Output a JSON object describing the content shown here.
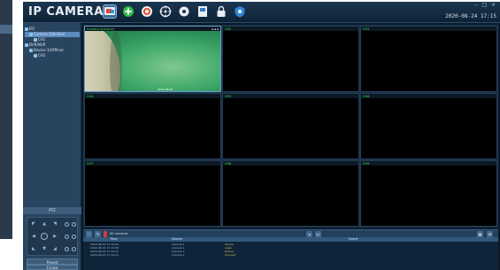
{
  "app": {
    "title": "IP CAMERA",
    "datetime": "2020-08-24 17:15"
  },
  "toolbar_icons": [
    {
      "name": "live-view-icon",
      "active": true
    },
    {
      "name": "add-camera-icon",
      "active": false
    },
    {
      "name": "playback-icon",
      "active": false
    },
    {
      "name": "ptz-icon",
      "active": false
    },
    {
      "name": "settings-icon",
      "active": false
    },
    {
      "name": "records-icon",
      "active": false
    },
    {
      "name": "lock-icon",
      "active": false
    },
    {
      "name": "info-icon",
      "active": false
    }
  ],
  "device_tree": [
    {
      "level": 1,
      "label": "IPC",
      "selected": false
    },
    {
      "level": 2,
      "label": "Camera 1(Online)",
      "selected": true
    },
    {
      "level": 3,
      "label": "CH1",
      "selected": false
    },
    {
      "level": 1,
      "label": "DVR/NVR",
      "selected": false
    },
    {
      "level": 2,
      "label": "Device 1(Offline)",
      "selected": false
    },
    {
      "level": 3,
      "label": "CH1",
      "selected": false
    }
  ],
  "left_panel": {
    "ptz_label": "PTZ",
    "button_1": "Preset",
    "button_2": "Cruise"
  },
  "grid": {
    "columns": 3,
    "rows": 3,
    "cells": [
      {
        "label": "Camera 1(Online)",
        "feed": true
      },
      {
        "label": "CH2",
        "feed": false
      },
      {
        "label": "CH3",
        "feed": false
      },
      {
        "label": "CH4",
        "feed": false
      },
      {
        "label": "CH5",
        "feed": false
      },
      {
        "label": "CH6",
        "feed": false
      },
      {
        "label": "CH7",
        "feed": false
      },
      {
        "label": "CH8",
        "feed": false
      },
      {
        "label": "CH9",
        "feed": false
      }
    ],
    "feed_timestamp": "2020-08-24"
  },
  "bottom_toolbar": {
    "status_text": "All cameras"
  },
  "log": {
    "headers": [
      "Time",
      "Device",
      "Event"
    ],
    "rows": [
      [
        "2020-08-24 17:15:02",
        "Camera 1",
        "Online"
      ],
      [
        "2020-08-24 17:14:58",
        "Camera 1",
        "Login"
      ],
      [
        "2020-08-24 17:14:41",
        "Camera 1",
        "Online"
      ],
      [
        "2020-08-24 17:14:10",
        "Camera 1",
        "Connect"
      ]
    ]
  },
  "colors": {
    "accent": "#3b6e9b",
    "label_green": "#36e84e",
    "panel": "#29445f"
  }
}
